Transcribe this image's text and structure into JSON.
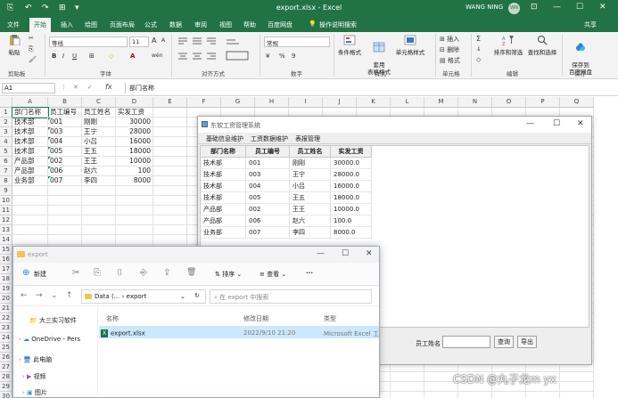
{
  "excel": {
    "quick_access": [
      "⎘",
      "↶",
      "↷",
      "⊞",
      "▾"
    ],
    "title": "export.xlsx - Excel",
    "user": "WANG NING",
    "avatar": "WN",
    "window_buttons": [
      "⊡",
      "—",
      "☐",
      "✕"
    ],
    "menu": [
      "文件",
      "开始",
      "插入",
      "绘图",
      "页面布局",
      "公式",
      "数据",
      "审阅",
      "视图",
      "帮助",
      "百度网盘",
      "操作说明搜索"
    ],
    "share": "共享",
    "ribbon": {
      "paste": "粘贴",
      "cut": "✂",
      "copy": "⎘",
      "format_painter": "🖌",
      "clipboard_label": "剪贴板",
      "font_name": "等线",
      "font_size": "11",
      "grow_font": "A",
      "shrink_font": "A",
      "bold": "B",
      "italic": "I",
      "underline": "U",
      "borders": "⊞",
      "fill_color": "◇",
      "font_color": "A",
      "pinyin": "wén",
      "font_label": "字体",
      "align_label": "对齐方式",
      "number_format": "常规",
      "number_label": "数字",
      "currency": "¥",
      "percent": "%",
      "comma": "9",
      "conditional": "条件格式",
      "table_format": "套用\n表格格式",
      "cell_style": "单元格样式",
      "style_label": "样式",
      "insert": "插入",
      "delete": "删除",
      "format": "格式",
      "cells_label": "单元格",
      "sigma": "Σ",
      "fill": "↓",
      "clear": "◇",
      "sort_filter": "排序和筛选",
      "find_select": "查找和选择",
      "edit_label": "编辑",
      "save_baidu": "保存到\n百度网盘",
      "save_label": "保存"
    },
    "name_box": "A1",
    "formula_icons": [
      "⋮",
      "✕",
      "✓"
    ],
    "fx": "fx",
    "formula": "部门名称",
    "columns": [
      "A",
      "B",
      "C",
      "D",
      "E",
      "F",
      "G",
      "H",
      "I",
      "J",
      "K",
      "L",
      "M",
      "N",
      "O",
      "P",
      "Q"
    ],
    "rows": [
      "1",
      "2",
      "3",
      "4",
      "5",
      "6",
      "7",
      "8",
      "9",
      "10",
      "11",
      "12",
      "13",
      "14",
      "15",
      "16",
      "17",
      "18",
      "19",
      "20",
      "21",
      "22",
      "23",
      "24",
      "25",
      "26",
      "27",
      "28",
      "29",
      "30"
    ],
    "sheet": [
      [
        "部门名称",
        "员工编号",
        "员工姓名",
        "实发工资"
      ],
      [
        "技术部",
        "001",
        "刚刚",
        "30000"
      ],
      [
        "技术部",
        "003",
        "王宁",
        "28000"
      ],
      [
        "技术部",
        "004",
        "小吕",
        "16000"
      ],
      [
        "技术部",
        "005",
        "王五",
        "18000"
      ],
      [
        "产品部",
        "002",
        "王王",
        "10000"
      ],
      [
        "产品部",
        "006",
        "赵六",
        "100"
      ],
      [
        "业务部",
        "007",
        "李四",
        "8000"
      ]
    ]
  },
  "swing": {
    "title": "东软工资管理系统",
    "window_buttons": [
      "—",
      "☐",
      "✕"
    ],
    "menus": [
      "基础信息维护",
      "工资数据维护",
      "表报管理"
    ],
    "headers": [
      "部门名称",
      "员工编号",
      "员工姓名",
      "实发工资"
    ],
    "rows": [
      [
        "技术部",
        "001",
        "刚刚",
        "30000.0"
      ],
      [
        "技术部",
        "003",
        "王宁",
        "28000.0"
      ],
      [
        "技术部",
        "004",
        "小吕",
        "16000.0"
      ],
      [
        "技术部",
        "005",
        "王五",
        "18000.0"
      ],
      [
        "产品部",
        "002",
        "王王",
        "10000.0"
      ],
      [
        "产品部",
        "006",
        "赵六",
        "100.0"
      ],
      [
        "业务部",
        "007",
        "李四",
        "8000.0"
      ]
    ],
    "name_label": "员工姓名",
    "query_button": "查询",
    "export_button": "导出"
  },
  "explorer": {
    "tab": "export",
    "window_buttons": [
      "—",
      "☐",
      "✕"
    ],
    "new_label": "新建",
    "toolbar_icons": [
      "✂",
      "⎘",
      "⌷",
      "⎆",
      "⇪",
      "🗑"
    ],
    "sort_label": "排序",
    "view_label": "查看",
    "more": "···",
    "nav_icons": [
      "←",
      "→",
      "⌄",
      "↑"
    ],
    "path": [
      "Data (...",
      "›",
      "export"
    ],
    "path_caret": "⌄",
    "refresh": "↻",
    "search_placeholder": "在 export 中搜索",
    "sidebar": [
      {
        "label": "大三实习软件",
        "icon": "folder"
      },
      {
        "label": "OneDrive - Pers",
        "icon": "cloud"
      },
      {
        "label": "此电脑",
        "icon": "computer"
      },
      {
        "label": "视频",
        "icon": "video"
      },
      {
        "label": "图片",
        "icon": "picture"
      }
    ],
    "columns": [
      "名称",
      "修改日期",
      "类型"
    ],
    "file": {
      "name": "export.xlsx",
      "date": "2022/9/10 21:20",
      "type": "Microsoft Excel 工..."
    }
  },
  "watermark": "CSDN @丸子龙m yx"
}
